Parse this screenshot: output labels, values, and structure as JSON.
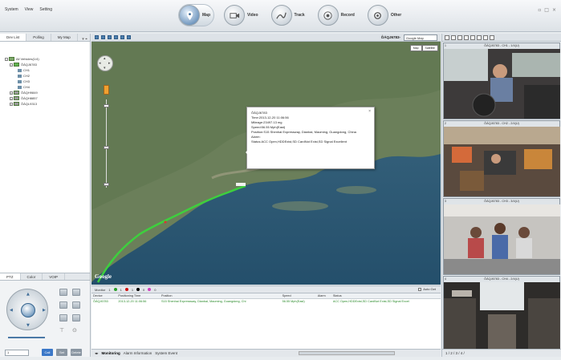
{
  "menu": [
    "System",
    "View",
    "Setting"
  ],
  "modes": [
    {
      "label": "Map",
      "icon": "map-icon",
      "active": true
    },
    {
      "label": "Video",
      "icon": "video-icon"
    },
    {
      "label": "Track",
      "icon": "track-icon"
    },
    {
      "label": "Record",
      "icon": "record-icon"
    },
    {
      "label": "Other",
      "icon": "other-icon"
    }
  ],
  "left": {
    "tabs": [
      "Dev List",
      "Polling",
      "My Map"
    ],
    "tree": {
      "root": "All Vehicles(1/4)",
      "vehicle": "ÔÁQJ6783",
      "channels": [
        "CH1",
        "CH2",
        "CH3",
        "CH4"
      ],
      "others": [
        "ÔÁQH9849",
        "ÔÁQH8857",
        "ÔÁQL9313"
      ]
    },
    "ptz_tabs": [
      "PTZ",
      "Color",
      "VOIP"
    ],
    "preset": "1",
    "buttons": [
      "Call",
      "Set",
      "Delete"
    ]
  },
  "map": {
    "title": "ÔÁQJ6783-",
    "provider": "Google Map",
    "types": [
      "Map",
      "Satellite"
    ],
    "attribution": "Google",
    "popup": {
      "lines": [
        "ÔÁQJ6783",
        "Time:2013-12-20 11:06:56",
        "Mileage:23497.13 mg",
        "Speed:56.55 Mph(East)",
        "Position:S15 Shenhai Expressway, Dianbai, Maoming, Guangdong, China",
        "Alarm:",
        "Status:ACC Open,HDDExist,SD CardNot Exist,SD Signal Excellent"
      ]
    }
  },
  "monitor": {
    "label": "Monitor",
    "counts": [
      {
        "n": "1",
        "color": "#2aa02a"
      },
      {
        "n": "1",
        "color": "#d01010"
      },
      {
        "n": "0",
        "color": "#000000"
      },
      {
        "n": "0",
        "color": "#d040c0"
      }
    ],
    "auto_get": "Auto Get",
    "columns": [
      "Device",
      "Positioning Time",
      "Position",
      "Speed",
      "Alarm",
      "Status"
    ],
    "rows": [
      [
        "ÔÁQJ6783",
        "2013-12-20 11:06:56",
        "S15 Shenhai Expressway, Dianbai, Maoming, Guangdong, Chi",
        "56.55 Mph(East)",
        "",
        "ACC Open,HDDExist,SD CardNot Exist,SD Signal Excel"
      ]
    ],
    "tabs": [
      "Monitoring",
      "Alarm Information",
      "System Event"
    ]
  },
  "videos": [
    {
      "n": "1",
      "title": "ÔÁQJ6783 - CH1 - 1/4(U)"
    },
    {
      "n": "2",
      "title": "ÔÁQJ6783 - CH2 - 2/4(U)"
    },
    {
      "n": "3",
      "title": "ÔÁQJ6783 - CH3 - 3/4(U)"
    },
    {
      "n": "4",
      "title": "ÔÁQJ6783 - CH4 - 2/4(U)"
    }
  ],
  "right_tabs": "1 / 2 / 3 / 4 /"
}
